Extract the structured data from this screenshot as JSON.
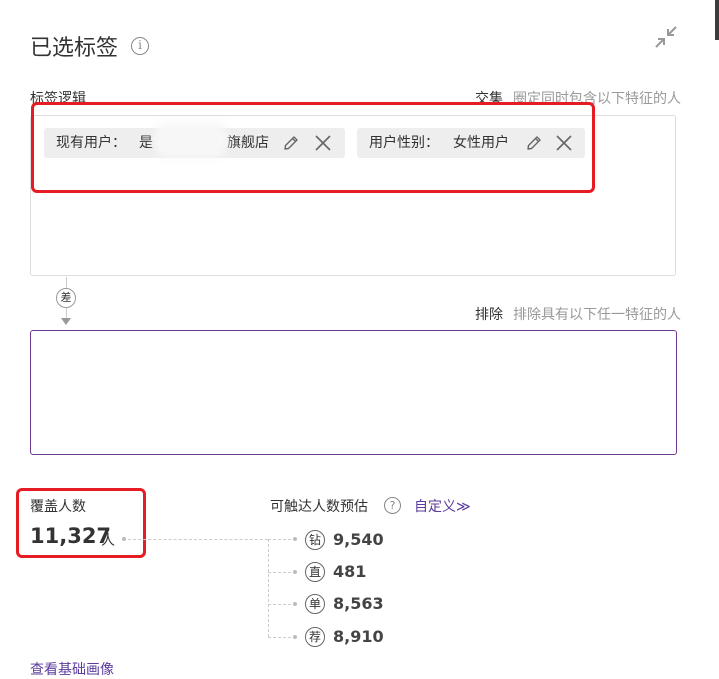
{
  "header": {
    "title": "已选标签",
    "info_icon": "i",
    "collapse_icon": "collapse-arrows-icon"
  },
  "logic": {
    "label": "标签逻辑",
    "intersect_keyword": "交集",
    "intersect_desc": "圈定同时包含以下特征的人",
    "tags": [
      {
        "key": "现有用户：",
        "value_prefix": "是",
        "value_suffix": "旗舰店"
      },
      {
        "key": "用户性别：",
        "value_prefix": "女性用户",
        "value_suffix": ""
      }
    ]
  },
  "difference": {
    "badge": "差"
  },
  "exclude": {
    "keyword": "排除",
    "desc": "排除具有以下任一特征的人"
  },
  "coverage": {
    "label": "覆盖人数",
    "value": "11,327",
    "unit": "人"
  },
  "reach": {
    "label": "可触达人数预估",
    "help_icon": "?",
    "custom_link": "自定义≫",
    "channels": [
      {
        "badge": "钻",
        "value": "9,540"
      },
      {
        "badge": "直",
        "value": "481"
      },
      {
        "badge": "单",
        "value": "8,563"
      },
      {
        "badge": "荐",
        "value": "8,910"
      }
    ]
  },
  "footer": {
    "base_profile_link": "查看基础画像"
  },
  "colors": {
    "accent": "#5b3c9c",
    "highlight": "#e51c23",
    "exclude_border": "#6f3b8f"
  }
}
